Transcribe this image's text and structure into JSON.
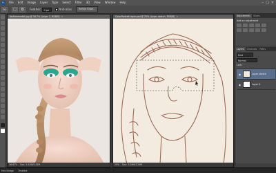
{
  "app": {
    "icon_label": "Ps"
  },
  "menubar": {
    "items": [
      "File",
      "Edit",
      "Image",
      "Layer",
      "Type",
      "Select",
      "Filter",
      "3D",
      "View",
      "Window",
      "Help"
    ],
    "window_controls": [
      "–",
      "□",
      "×"
    ]
  },
  "options": {
    "feather_label": "Feather:",
    "feather_value": "0 px",
    "antialias_label": "Anti-alias",
    "refine_label": "Refine Edge..."
  },
  "doc1": {
    "tab": "fashionmodel.jpg @ 16.7% (Layer 1, RGB/8)",
    "status_zoom": "16.67%",
    "status_doc": "Doc: 5.42M/5.42M"
  },
  "doc2": {
    "tab": "ColorPortraitLayer.psd @ 25% (Layer sketch, RGB/8)",
    "status_zoom": "25%",
    "status_doc": "Doc: 3.29M/3.29M"
  },
  "panels": {
    "top_tabs": [
      "Adjustments",
      "Styles"
    ],
    "adjust_hint": "Add an adjustment",
    "layer_tabs": [
      "Layers",
      "Channels",
      "Paths"
    ],
    "kind_label": "Kind",
    "blend_mode": "Normal",
    "lock_label": "Lock:",
    "layers": [
      {
        "name": "Layer sketch",
        "selected": true
      },
      {
        "name": "Layer 0",
        "selected": false
      }
    ]
  },
  "taskbar": {
    "items": [
      "Mini Bridge",
      "Timeline"
    ]
  },
  "colors": {
    "ui_dark": "#3c3c3c",
    "panel": "#4a4a4a",
    "sketch_line": "#9a6a56",
    "canvas": "#f4ebe0",
    "selection": "#5a6f8c"
  }
}
